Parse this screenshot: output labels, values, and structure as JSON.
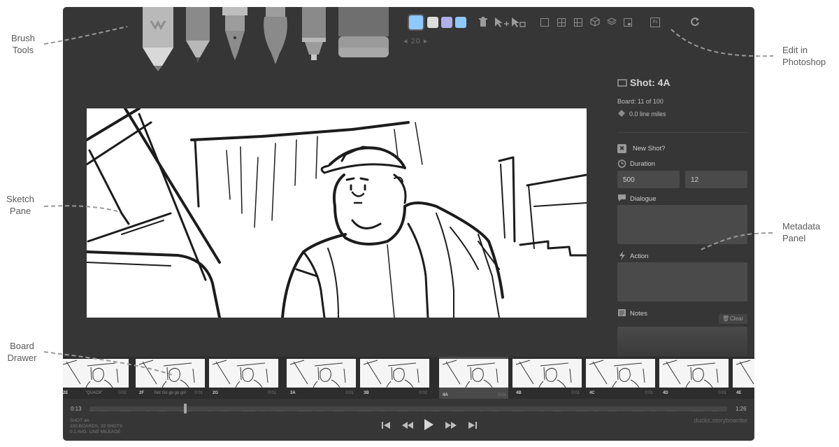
{
  "callouts": {
    "brush_tools": [
      "Brush",
      "Tools"
    ],
    "edit_in_photoshop": [
      "Edit in",
      "Photoshop"
    ],
    "sketch_pane": [
      "Sketch",
      "Pane"
    ],
    "metadata_panel": [
      "Metadata",
      "Panel"
    ],
    "board_drawer": [
      "Board",
      "Drawer"
    ]
  },
  "toolbar": {
    "brushes": [
      "light-pencil-icon",
      "pencil-icon",
      "pen-icon",
      "brush-icon",
      "note-pen-icon",
      "eraser-icon"
    ],
    "swatches": [
      "#8fc7ff",
      "#dcdcdc",
      "#b0b0ea",
      "#8fc7ff"
    ],
    "brush_size": "20",
    "photoshop_label": "Ps"
  },
  "metadata": {
    "shot_title": "Shot: 4A",
    "board_position": "Board: 11 of 100",
    "line_miles": "0.0 line miles",
    "new_shot_label": "New Shot?",
    "duration_label": "Duration",
    "duration_ms": "500",
    "duration_frames": "12",
    "dialogue_label": "Dialogue",
    "action_label": "Action",
    "notes_label": "Notes",
    "clear_label": "Clear"
  },
  "boards": [
    {
      "num": "2E",
      "caption": "\"QUACK\"",
      "dur": "0:02",
      "selected": false
    },
    {
      "num": "2F",
      "caption": "Not Go go go go!",
      "dur": "0:01",
      "selected": false
    },
    {
      "num": "2G",
      "caption": "",
      "dur": "0:01",
      "selected": false
    },
    {
      "num": "3A",
      "caption": "",
      "dur": "0:01",
      "selected": false
    },
    {
      "num": "3B",
      "caption": "",
      "dur": "0:02",
      "selected": false
    },
    {
      "num": "4A",
      "caption": "",
      "dur": "0:01",
      "selected": true
    },
    {
      "num": "4B",
      "caption": "",
      "dur": "0:01",
      "selected": false
    },
    {
      "num": "4C",
      "caption": "",
      "dur": "0:01",
      "selected": false
    },
    {
      "num": "4D",
      "caption": "",
      "dur": "0:01",
      "selected": false
    },
    {
      "num": "4E",
      "caption": "",
      "dur": "",
      "selected": false
    }
  ],
  "timeline": {
    "current": "0:13",
    "total": "1:26",
    "progress": 0.15
  },
  "status": {
    "line1": "SHOT 4A",
    "line2": "100 BOARDS, 29 SHOTS",
    "line3": "0.1 AVG. LINE MILEAGE"
  },
  "transport": [
    "skip-back-icon",
    "rewind-icon",
    "play-icon",
    "fast-forward-icon",
    "skip-forward-icon"
  ],
  "project_name": "ducks.storyboarder"
}
